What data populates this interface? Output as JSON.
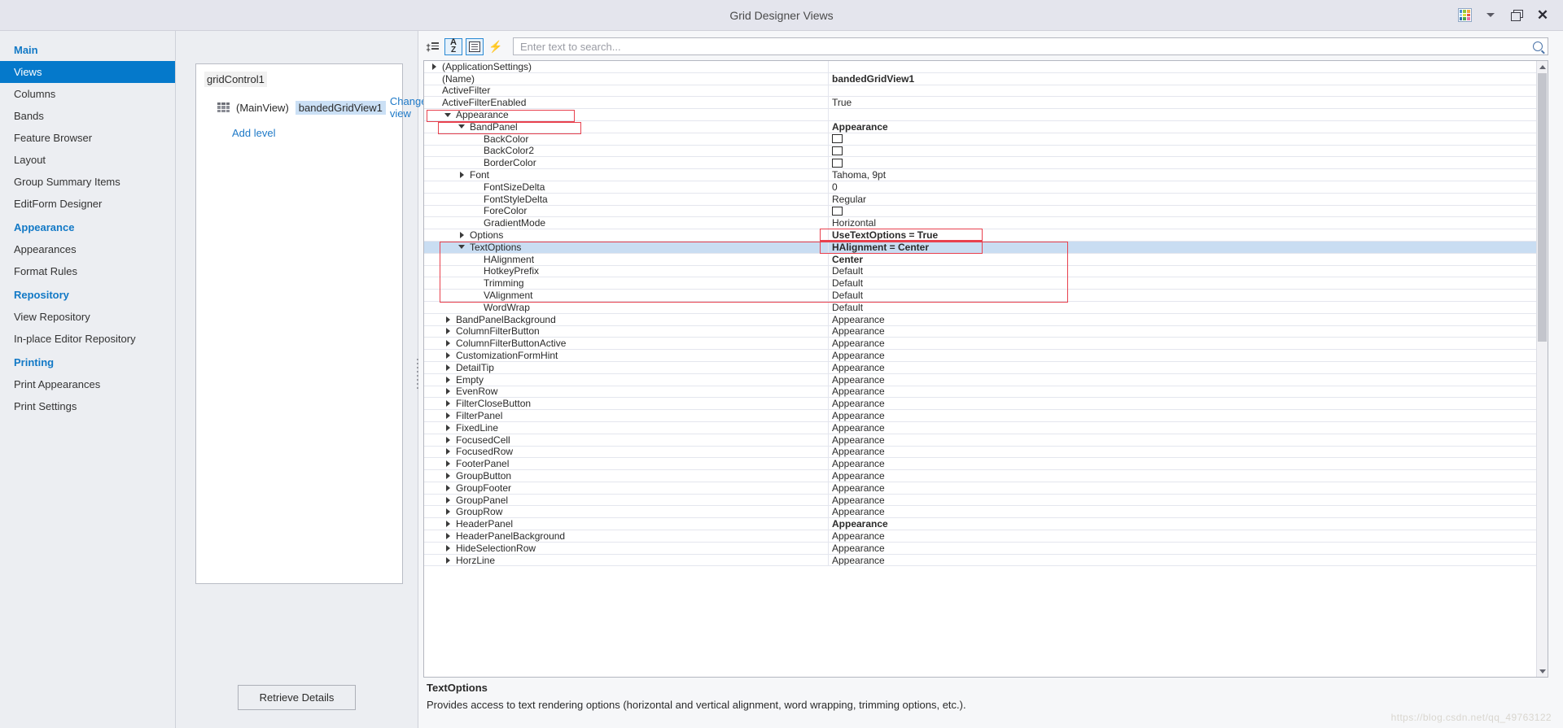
{
  "window": {
    "title": "Grid Designer Views",
    "buttons": {
      "palette": "palette-button",
      "dropdown": "dropdown-button",
      "restore": "restore-button",
      "close": "✕"
    }
  },
  "sidebar": {
    "groups": [
      {
        "label": "Main",
        "items": [
          {
            "label": "Views",
            "active": true
          },
          {
            "label": "Columns",
            "active": false
          },
          {
            "label": "Bands",
            "active": false
          },
          {
            "label": "Feature Browser",
            "active": false
          },
          {
            "label": "Layout",
            "active": false
          },
          {
            "label": "Group Summary Items",
            "active": false
          },
          {
            "label": "EditForm Designer",
            "active": false
          }
        ]
      },
      {
        "label": "Appearance",
        "items": [
          {
            "label": "Appearances",
            "active": false
          },
          {
            "label": "Format Rules",
            "active": false
          }
        ]
      },
      {
        "label": "Repository",
        "items": [
          {
            "label": "View Repository",
            "active": false
          },
          {
            "label": "In-place Editor Repository",
            "active": false
          }
        ]
      },
      {
        "label": "Printing",
        "items": [
          {
            "label": "Print Appearances",
            "active": false
          },
          {
            "label": "Print Settings",
            "active": false
          }
        ]
      }
    ]
  },
  "views_panel": {
    "root_label": "gridControl1",
    "level": {
      "name": "(MainView)",
      "view": "bandedGridView1",
      "change_link": "Change view"
    },
    "add_level": "Add level",
    "retrieve_button": "Retrieve Details"
  },
  "prop_toolbar": {
    "categorized_title": "Categorized",
    "alphabetical_title": "Alphabetical",
    "properties_title": "Properties",
    "events_title": "Events",
    "az_top": "A",
    "az_bottom": "Z",
    "bolt": "⚡"
  },
  "search": {
    "placeholder": "Enter text to search...",
    "value": ""
  },
  "grid": {
    "rows": [
      {
        "name": "(ApplicationSettings)",
        "value": "",
        "indent": 0,
        "expander": "right",
        "bold_value": false,
        "selected": false
      },
      {
        "name": "(Name)",
        "value": "bandedGridView1",
        "indent": 0,
        "expander": "none",
        "bold_value": true,
        "selected": false
      },
      {
        "name": "ActiveFilter",
        "value": "",
        "indent": 0,
        "expander": "none",
        "bold_value": false,
        "selected": false
      },
      {
        "name": "ActiveFilterEnabled",
        "value": "True",
        "indent": 0,
        "expander": "none",
        "bold_value": false,
        "selected": false
      },
      {
        "name": "Appearance",
        "value": "",
        "indent": 1,
        "expander": "down",
        "bold_value": false,
        "selected": false
      },
      {
        "name": "BandPanel",
        "value": "Appearance",
        "indent": 2,
        "expander": "down",
        "bold_value": true,
        "selected": false
      },
      {
        "name": "BackColor",
        "value": "",
        "indent": 3,
        "expander": "none",
        "bold_value": false,
        "selected": false,
        "swatch": "#ffffff"
      },
      {
        "name": "BackColor2",
        "value": "",
        "indent": 3,
        "expander": "none",
        "bold_value": false,
        "selected": false,
        "swatch": "#ffffff"
      },
      {
        "name": "BorderColor",
        "value": "",
        "indent": 3,
        "expander": "none",
        "bold_value": false,
        "selected": false,
        "swatch": "#ffffff"
      },
      {
        "name": "Font",
        "value": "Tahoma, 9pt",
        "indent": 2,
        "expander": "right",
        "bold_value": false,
        "selected": false
      },
      {
        "name": "FontSizeDelta",
        "value": "0",
        "indent": 3,
        "expander": "none",
        "bold_value": false,
        "selected": false
      },
      {
        "name": "FontStyleDelta",
        "value": "Regular",
        "indent": 3,
        "expander": "none",
        "bold_value": false,
        "selected": false
      },
      {
        "name": "ForeColor",
        "value": "",
        "indent": 3,
        "expander": "none",
        "bold_value": false,
        "selected": false,
        "swatch": "#ffffff"
      },
      {
        "name": "GradientMode",
        "value": "Horizontal",
        "indent": 3,
        "expander": "none",
        "bold_value": false,
        "selected": false
      },
      {
        "name": "Options",
        "value": "UseTextOptions = True",
        "indent": 2,
        "expander": "right",
        "bold_value": true,
        "selected": false
      },
      {
        "name": "TextOptions",
        "value": "HAlignment = Center",
        "indent": 2,
        "expander": "down",
        "bold_value": true,
        "selected": true
      },
      {
        "name": "HAlignment",
        "value": "Center",
        "indent": 3,
        "expander": "none",
        "bold_value": true,
        "selected": false
      },
      {
        "name": "HotkeyPrefix",
        "value": "Default",
        "indent": 3,
        "expander": "none",
        "bold_value": false,
        "selected": false
      },
      {
        "name": "Trimming",
        "value": "Default",
        "indent": 3,
        "expander": "none",
        "bold_value": false,
        "selected": false
      },
      {
        "name": "VAlignment",
        "value": "Default",
        "indent": 3,
        "expander": "none",
        "bold_value": false,
        "selected": false
      },
      {
        "name": "WordWrap",
        "value": "Default",
        "indent": 3,
        "expander": "none",
        "bold_value": false,
        "selected": false
      },
      {
        "name": "BandPanelBackground",
        "value": "Appearance",
        "indent": 1,
        "expander": "right",
        "bold_value": false,
        "selected": false
      },
      {
        "name": "ColumnFilterButton",
        "value": "Appearance",
        "indent": 1,
        "expander": "right",
        "bold_value": false,
        "selected": false
      },
      {
        "name": "ColumnFilterButtonActive",
        "value": "Appearance",
        "indent": 1,
        "expander": "right",
        "bold_value": false,
        "selected": false
      },
      {
        "name": "CustomizationFormHint",
        "value": "Appearance",
        "indent": 1,
        "expander": "right",
        "bold_value": false,
        "selected": false
      },
      {
        "name": "DetailTip",
        "value": "Appearance",
        "indent": 1,
        "expander": "right",
        "bold_value": false,
        "selected": false
      },
      {
        "name": "Empty",
        "value": "Appearance",
        "indent": 1,
        "expander": "right",
        "bold_value": false,
        "selected": false
      },
      {
        "name": "EvenRow",
        "value": "Appearance",
        "indent": 1,
        "expander": "right",
        "bold_value": false,
        "selected": false
      },
      {
        "name": "FilterCloseButton",
        "value": "Appearance",
        "indent": 1,
        "expander": "right",
        "bold_value": false,
        "selected": false
      },
      {
        "name": "FilterPanel",
        "value": "Appearance",
        "indent": 1,
        "expander": "right",
        "bold_value": false,
        "selected": false
      },
      {
        "name": "FixedLine",
        "value": "Appearance",
        "indent": 1,
        "expander": "right",
        "bold_value": false,
        "selected": false
      },
      {
        "name": "FocusedCell",
        "value": "Appearance",
        "indent": 1,
        "expander": "right",
        "bold_value": false,
        "selected": false
      },
      {
        "name": "FocusedRow",
        "value": "Appearance",
        "indent": 1,
        "expander": "right",
        "bold_value": false,
        "selected": false
      },
      {
        "name": "FooterPanel",
        "value": "Appearance",
        "indent": 1,
        "expander": "right",
        "bold_value": false,
        "selected": false
      },
      {
        "name": "GroupButton",
        "value": "Appearance",
        "indent": 1,
        "expander": "right",
        "bold_value": false,
        "selected": false
      },
      {
        "name": "GroupFooter",
        "value": "Appearance",
        "indent": 1,
        "expander": "right",
        "bold_value": false,
        "selected": false
      },
      {
        "name": "GroupPanel",
        "value": "Appearance",
        "indent": 1,
        "expander": "right",
        "bold_value": false,
        "selected": false
      },
      {
        "name": "GroupRow",
        "value": "Appearance",
        "indent": 1,
        "expander": "right",
        "bold_value": false,
        "selected": false
      },
      {
        "name": "HeaderPanel",
        "value": "Appearance",
        "indent": 1,
        "expander": "right",
        "bold_value": true,
        "selected": false
      },
      {
        "name": "HeaderPanelBackground",
        "value": "Appearance",
        "indent": 1,
        "expander": "right",
        "bold_value": false,
        "selected": false
      },
      {
        "name": "HideSelectionRow",
        "value": "Appearance",
        "indent": 1,
        "expander": "right",
        "bold_value": false,
        "selected": false
      },
      {
        "name": "HorzLine",
        "value": "Appearance",
        "indent": 1,
        "expander": "right",
        "bold_value": false,
        "selected": false
      }
    ]
  },
  "description": {
    "title": "TextOptions",
    "text": "Provides access to text rendering options (horizontal and vertical alignment, word wrapping, trimming options, etc.)."
  },
  "watermark": "https://blog.csdn.net/qq_49763122",
  "colors": {
    "accent": "#0579cb",
    "group_heading": "#1279c6",
    "selection": "#c9ddf2",
    "annotation": "#e8414e",
    "titlebar": "#e4e5ed",
    "sidebar": "#eceef2"
  }
}
